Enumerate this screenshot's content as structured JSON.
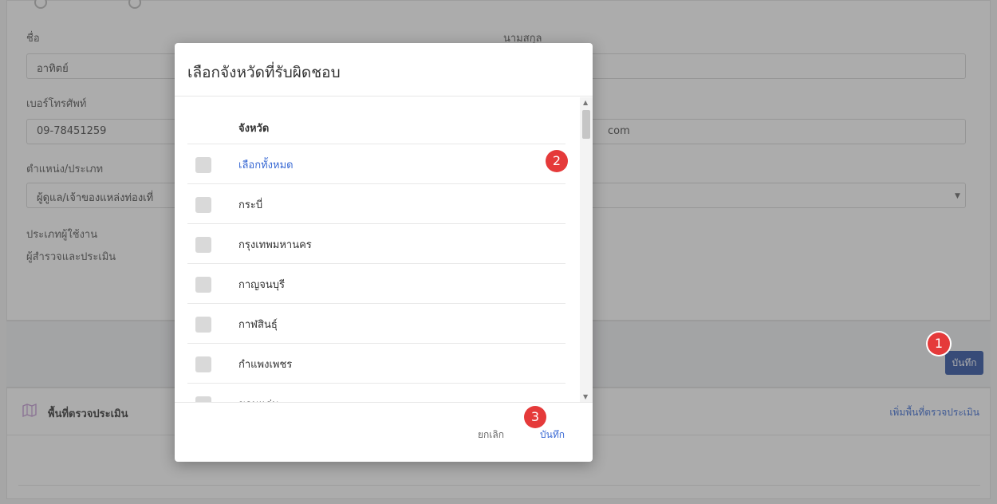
{
  "form": {
    "first_name_label": "ชื่อ",
    "first_name_value": "อาทิตย์",
    "last_name_label": "นามสกุล",
    "phone_label": "เบอร์โทรศัพท์",
    "phone_value": "09-78451259",
    "email_value_tail": "com",
    "position_label": "ตำแหน่ง/ประเภท",
    "position_value": "ผู้ดูแล/เจ้าของแหล่งท่องเที่",
    "user_type_label": "ประเภทผู้ใช้งาน",
    "user_type_value": "ผู้สำรวจและประเมิน"
  },
  "save_bar": {
    "save_label": "บันทึก"
  },
  "assessment_area": {
    "title": "พื้นที่ตรวจประเมิน",
    "add_link": "เพิ่มพื้นที่ตรวจประเมิน"
  },
  "modal": {
    "title": "เลือกจังหวัดที่รับผิดชอบ",
    "column_header": "จังหวัด",
    "select_all": "เลือกทั้งหมด",
    "provinces": [
      "กระบี่",
      "กรุงเทพมหานคร",
      "กาญจนบุรี",
      "กาฬสินธุ์",
      "กำแพงเพชร",
      "ขอนแก่น"
    ],
    "cancel_label": "ยกเลิก",
    "ok_label": "บันทึก"
  },
  "badges": {
    "one": "1",
    "two": "2",
    "three": "3"
  },
  "colors": {
    "primary": "#2b4fa0",
    "link": "#3a6ad4",
    "badge": "#e53a3a"
  }
}
